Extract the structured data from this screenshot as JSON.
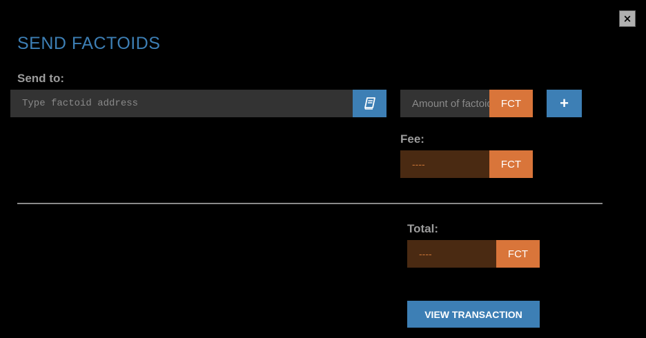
{
  "dialog": {
    "title": "SEND FACTOIDS",
    "close_label": "×"
  },
  "send_to": {
    "label": "Send to:",
    "address_placeholder": "Type factoid address",
    "address_value": "",
    "address_book_icon": "address-book-icon"
  },
  "amount": {
    "placeholder": "Amount of factoids",
    "value": "",
    "currency": "FCT",
    "add_label": "+"
  },
  "fee": {
    "label": "Fee:",
    "value": "----",
    "currency": "FCT"
  },
  "total": {
    "label": "Total:",
    "value": "----",
    "currency": "FCT"
  },
  "actions": {
    "view_transaction_label": "VIEW TRANSACTION"
  },
  "colors": {
    "background": "#000000",
    "accent_blue": "#3d7fb5",
    "accent_orange": "#d9753a",
    "field_dark_orange": "#4a2a12",
    "input_gray": "#333333"
  }
}
